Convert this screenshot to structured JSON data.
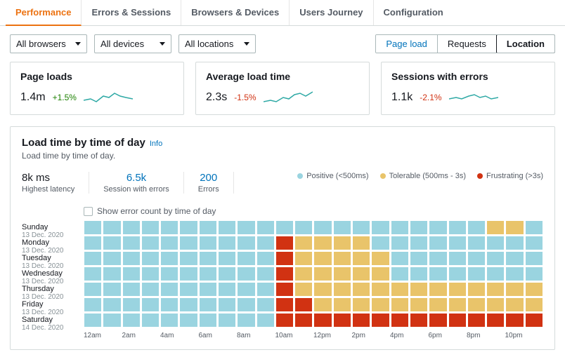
{
  "tabs": [
    "Performance",
    "Errors & Sessions",
    "Browsers & Devices",
    "Users Journey",
    "Configuration"
  ],
  "active_tab": 0,
  "filters": {
    "browser": "All browsers",
    "device": "All devices",
    "location": "All locations"
  },
  "segments": [
    "Page load",
    "Requests",
    "Location"
  ],
  "active_segment": 2,
  "cards": {
    "page_loads": {
      "title": "Page loads",
      "value": "1.4m",
      "delta": "+1.5%",
      "direction": "up"
    },
    "avg_load": {
      "title": "Average load time",
      "value": "2.3s",
      "delta": "-1.5%",
      "direction": "down"
    },
    "sess_err": {
      "title": "Sessions with errors",
      "value": "1.1k",
      "delta": "-2.1%",
      "direction": "down"
    }
  },
  "panel": {
    "title": "Load time by time of day",
    "info": "Info",
    "subtitle": "Load time by time of day.",
    "checkbox_label": "Show error count by time of day",
    "stats": [
      {
        "value": "8k ms",
        "label": "Highest latency",
        "link": false
      },
      {
        "value": "6.5k",
        "label": "Session with errors",
        "link": true
      },
      {
        "value": "200",
        "label": "Errors",
        "link": true
      }
    ],
    "legend": {
      "positive": "Positive (<500ms)",
      "tolerable": "Tolerable (500ms - 3s)",
      "frustrating": "Frustrating (>3s)"
    }
  },
  "chart_data": {
    "type": "heatmap",
    "x_categories": [
      "12am",
      "1am",
      "2am",
      "3am",
      "4am",
      "5am",
      "6am",
      "7am",
      "8am",
      "9am",
      "10am",
      "11am",
      "12pm",
      "1pm",
      "2pm",
      "3pm",
      "4pm",
      "5pm",
      "6pm",
      "7pm",
      "8pm",
      "9pm",
      "10pm",
      "11pm"
    ],
    "x_tick_labels": [
      "12am",
      "2am",
      "4am",
      "6am",
      "8am",
      "10am",
      "12pm",
      "2pm",
      "4pm",
      "6pm",
      "8pm",
      "10pm"
    ],
    "y_categories": [
      {
        "day": "Sunday",
        "date": "13 Dec. 2020"
      },
      {
        "day": "Monday",
        "date": "13 Dec. 2020"
      },
      {
        "day": "Tuesday",
        "date": "13 Dec. 2020"
      },
      {
        "day": "Wednesday",
        "date": "13 Dec. 2020"
      },
      {
        "day": "Thursday",
        "date": "13 Dec. 2020"
      },
      {
        "day": "Friday",
        "date": "13 Dec. 2020"
      },
      {
        "day": "Saturday",
        "date": "14 Dec. 2020"
      }
    ],
    "levels": {
      "p": "positive",
      "t": "tolerable",
      "f": "frustrating"
    },
    "grid": [
      [
        "p",
        "p",
        "p",
        "p",
        "p",
        "p",
        "p",
        "p",
        "p",
        "p",
        "p",
        "p",
        "p",
        "p",
        "p",
        "p",
        "p",
        "p",
        "p",
        "p",
        "p",
        "t",
        "t",
        "p"
      ],
      [
        "p",
        "p",
        "p",
        "p",
        "p",
        "p",
        "p",
        "p",
        "p",
        "p",
        "f",
        "t",
        "t",
        "t",
        "t",
        "p",
        "p",
        "p",
        "p",
        "p",
        "p",
        "p",
        "p",
        "p"
      ],
      [
        "p",
        "p",
        "p",
        "p",
        "p",
        "p",
        "p",
        "p",
        "p",
        "p",
        "f",
        "t",
        "t",
        "t",
        "t",
        "t",
        "p",
        "p",
        "p",
        "p",
        "p",
        "p",
        "p",
        "p"
      ],
      [
        "p",
        "p",
        "p",
        "p",
        "p",
        "p",
        "p",
        "p",
        "p",
        "p",
        "f",
        "t",
        "t",
        "t",
        "t",
        "t",
        "p",
        "p",
        "p",
        "p",
        "p",
        "p",
        "p",
        "p"
      ],
      [
        "p",
        "p",
        "p",
        "p",
        "p",
        "p",
        "p",
        "p",
        "p",
        "p",
        "f",
        "t",
        "t",
        "t",
        "t",
        "t",
        "t",
        "t",
        "t",
        "t",
        "t",
        "t",
        "t",
        "t"
      ],
      [
        "p",
        "p",
        "p",
        "p",
        "p",
        "p",
        "p",
        "p",
        "p",
        "p",
        "f",
        "f",
        "t",
        "t",
        "t",
        "t",
        "t",
        "t",
        "t",
        "t",
        "t",
        "t",
        "t",
        "t"
      ],
      [
        "p",
        "p",
        "p",
        "p",
        "p",
        "p",
        "p",
        "p",
        "p",
        "p",
        "f",
        "f",
        "f",
        "f",
        "f",
        "f",
        "f",
        "f",
        "f",
        "f",
        "f",
        "f",
        "f",
        "f"
      ]
    ]
  }
}
